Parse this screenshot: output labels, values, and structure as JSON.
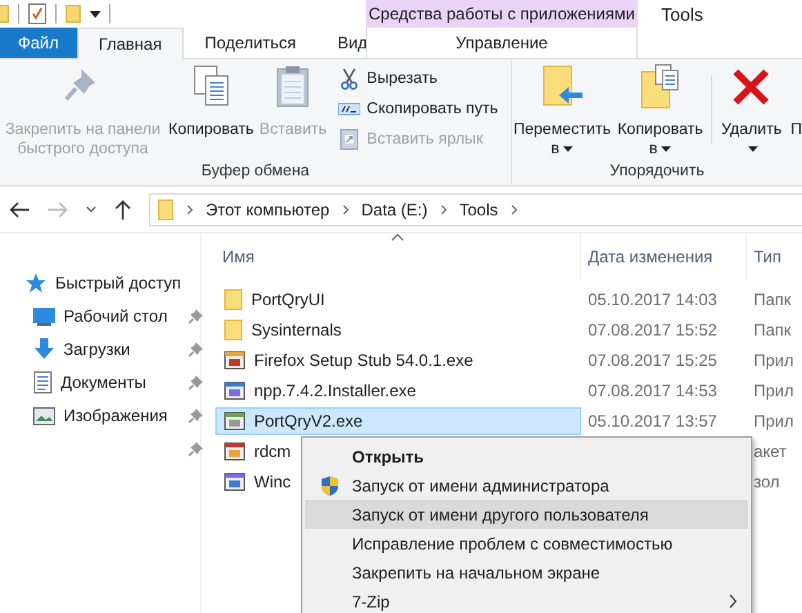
{
  "context_tab_header": "Средства работы с приложениями",
  "window": {
    "title": "Tools"
  },
  "tabs": [
    {
      "label": "Файл",
      "kind": "file",
      "selected": false
    },
    {
      "label": "Главная",
      "kind": "normal",
      "selected": true
    },
    {
      "label": "Поделиться",
      "kind": "normal",
      "selected": false
    },
    {
      "label": "Вид",
      "kind": "normal",
      "selected": false
    },
    {
      "label": "Управление",
      "kind": "contextual",
      "selected": false
    }
  ],
  "ribbon": {
    "groups": [
      {
        "label": "Буфер обмена",
        "commands": [
          {
            "label": "Закрепить на панели быстрого доступа",
            "kind": "large",
            "disabled": true
          },
          {
            "label": "Копировать",
            "kind": "large",
            "disabled": false
          },
          {
            "label": "Вставить",
            "kind": "large",
            "disabled": true
          },
          {
            "label": "Вырезать",
            "kind": "small",
            "disabled": false
          },
          {
            "label": "Скопировать путь",
            "kind": "small",
            "disabled": false
          },
          {
            "label": "Вставить ярлык",
            "kind": "small",
            "disabled": true
          }
        ]
      },
      {
        "label": "Упорядочить",
        "commands": [
          {
            "label": "Переместить в",
            "kind": "large",
            "dropdown": true,
            "disabled": false
          },
          {
            "label": "Копировать в",
            "kind": "large",
            "dropdown": true,
            "disabled": false
          },
          {
            "label": "Удалить",
            "kind": "large",
            "dropdown": true,
            "disabled": false
          },
          {
            "label": "П",
            "kind": "large",
            "disabled": false
          }
        ]
      }
    ]
  },
  "address": {
    "crumbs": [
      "Этот компьютер",
      "Data (E:)",
      "Tools"
    ]
  },
  "nav_pane": {
    "items": [
      {
        "label": "Быстрый доступ",
        "kind": "star",
        "pinned": false
      },
      {
        "label": "Рабочий стол",
        "kind": "desktop",
        "pinned": true
      },
      {
        "label": "Загрузки",
        "kind": "download",
        "pinned": true
      },
      {
        "label": "Документы",
        "kind": "document",
        "pinned": true
      },
      {
        "label": "Изображения",
        "kind": "image",
        "pinned": true
      },
      {
        "kind": "none",
        "pinned": true
      }
    ]
  },
  "file_list": {
    "columns": [
      {
        "label": "Имя",
        "sorted": true
      },
      {
        "label": "Дата изменения",
        "sorted": false
      },
      {
        "label": "Тип",
        "sorted": false
      }
    ],
    "rows": [
      {
        "name": "PortQryUI",
        "date": "05.10.2017 14:03",
        "type": "Папк",
        "kind": "folder",
        "selected": false
      },
      {
        "name": "Sysinternals",
        "date": "07.08.2017 15:52",
        "type": "Папк",
        "kind": "folder",
        "selected": false
      },
      {
        "name": "Firefox Setup Stub 54.0.1.exe",
        "date": "07.08.2017 15:25",
        "type": "Прил",
        "kind": "app",
        "selected": false
      },
      {
        "name": "npp.7.4.2.Installer.exe",
        "date": "07.08.2017 14:53",
        "type": "Прил",
        "kind": "app",
        "selected": false
      },
      {
        "name": "PortQryV2.exe",
        "date": "05.10.2017 13:57",
        "type": "Прил",
        "kind": "app",
        "selected": true
      },
      {
        "name": "rdcm",
        "type": "акет",
        "kind": "app",
        "selected": false
      },
      {
        "name": "Winc",
        "type": "зол",
        "kind": "app",
        "selected": false
      }
    ]
  },
  "context_menu": {
    "items": [
      {
        "label": "Открыть",
        "default": true,
        "shield": false,
        "submenu": false,
        "selected": false
      },
      {
        "label": "Запуск от имени администратора",
        "default": false,
        "shield": true,
        "submenu": false,
        "selected": false
      },
      {
        "label": "Запуск от имени другого пользователя",
        "default": false,
        "shield": false,
        "submenu": false,
        "selected": true
      },
      {
        "label": "Исправление проблем с совместимостью",
        "default": false,
        "shield": false,
        "submenu": false,
        "selected": false
      },
      {
        "label": "Закрепить на начальном экране",
        "default": false,
        "shield": false,
        "submenu": false,
        "selected": false
      },
      {
        "label": "7-Zip",
        "default": false,
        "shield": false,
        "submenu": true,
        "selected": false
      }
    ]
  }
}
